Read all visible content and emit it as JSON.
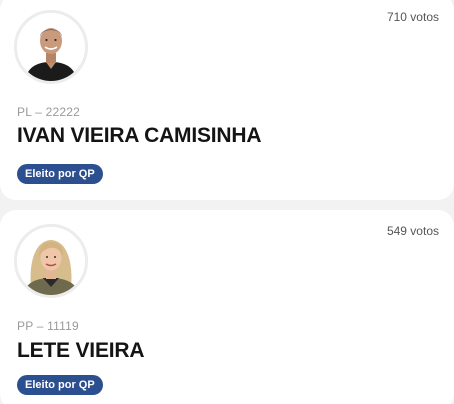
{
  "candidates": [
    {
      "votes": "710 votos",
      "party": "PL – 22222",
      "name": "IVAN VIEIRA CAMISINHA",
      "status_badge": "Eleito por QP",
      "photo": "candidate-photo-man"
    },
    {
      "votes": "549 votos",
      "party": "PP – 11119",
      "name": "LETE VIEIRA",
      "status_badge": "Eleito por QP",
      "photo": "candidate-photo-woman"
    }
  ],
  "colors": {
    "badge_background": "#2c4f8f",
    "badge_text": "#ffffff",
    "page_background": "#f2f2f2",
    "card_background": "#ffffff",
    "name_text": "#141414",
    "party_text": "#9a9a9a"
  }
}
